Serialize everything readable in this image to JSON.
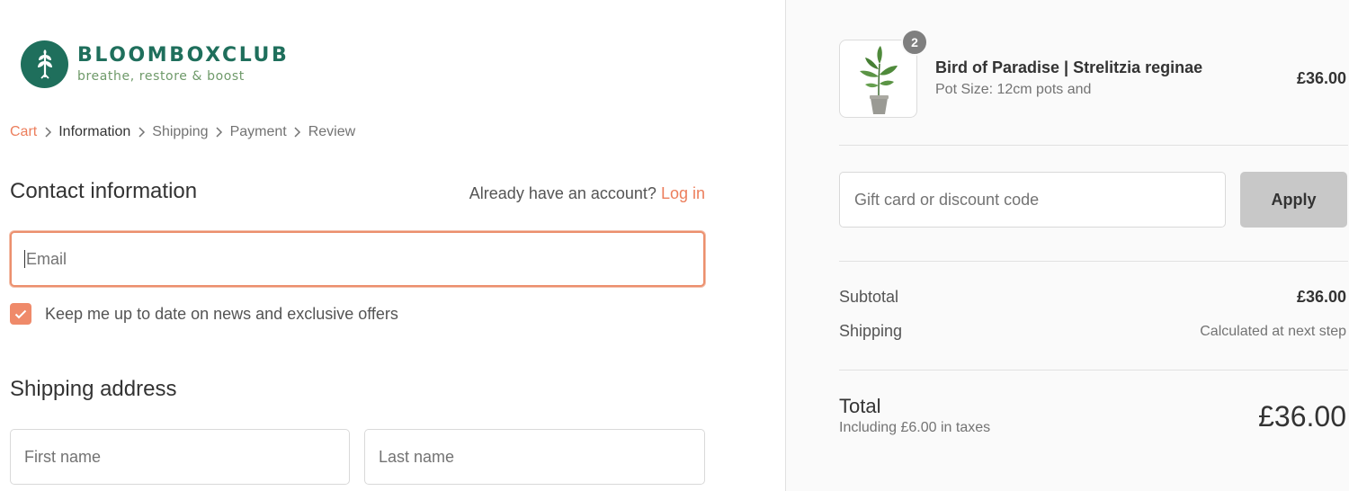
{
  "brand": {
    "name": "BLOOMBOXCLUB",
    "tagline": "breathe, restore & boost",
    "colors": {
      "primary": "#1f6f5c",
      "accent": "#ec7e5c"
    }
  },
  "breadcrumb": [
    {
      "label": "Cart",
      "state": "link"
    },
    {
      "label": "Information",
      "state": "current"
    },
    {
      "label": "Shipping",
      "state": "upcoming"
    },
    {
      "label": "Payment",
      "state": "upcoming"
    },
    {
      "label": "Review",
      "state": "upcoming"
    }
  ],
  "contact": {
    "title": "Contact information",
    "account_prompt": "Already have an account?",
    "login_label": "Log in",
    "email_placeholder": "Email",
    "newsletter_label": "Keep me up to date on news and exclusive offers",
    "newsletter_checked": true
  },
  "shipping_address": {
    "title": "Shipping address",
    "first_name_placeholder": "First name",
    "last_name_placeholder": "Last name"
  },
  "order_summary": {
    "item": {
      "name": "Bird of Paradise | Strelitzia reginae",
      "variant": "Pot Size: 12cm pots and",
      "price": "£36.00",
      "quantity": "2",
      "image_icon": "potted-plant"
    },
    "discount_placeholder": "Gift card or discount code",
    "apply_label": "Apply",
    "subtotal_label": "Subtotal",
    "subtotal_value": "£36.00",
    "shipping_label": "Shipping",
    "shipping_value": "Calculated at next step",
    "total_label": "Total",
    "total_tax_note": "Including £6.00 in taxes",
    "total_value": "£36.00"
  }
}
